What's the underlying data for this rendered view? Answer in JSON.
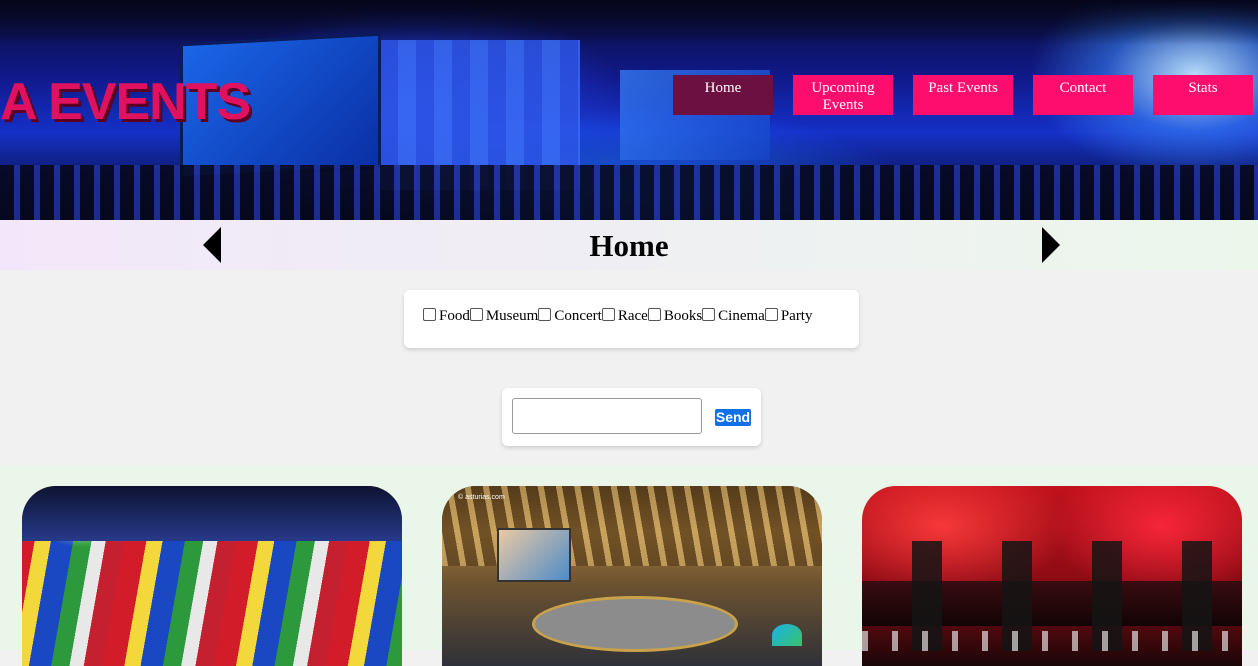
{
  "brand": {
    "logo_text": "A EVENTS",
    "accent_color": "#fc0d6e",
    "active_nav_color": "#6b1040"
  },
  "nav": {
    "items": [
      {
        "label": "Home",
        "active": true
      },
      {
        "label": "Upcoming Events",
        "active": false
      },
      {
        "label": "Past Events",
        "active": false
      },
      {
        "label": "Contact",
        "active": false
      },
      {
        "label": "Stats",
        "active": false
      }
    ]
  },
  "page": {
    "title": "Home",
    "prev_icon": "triangle-left-icon",
    "next_icon": "triangle-right-icon"
  },
  "filters": {
    "options": [
      {
        "label": "Food",
        "checked": false
      },
      {
        "label": "Museum",
        "checked": false
      },
      {
        "label": "Concert",
        "checked": false
      },
      {
        "label": "Race",
        "checked": false
      },
      {
        "label": "Books",
        "checked": false
      },
      {
        "label": "Cinema",
        "checked": false
      },
      {
        "label": "Party",
        "checked": false
      }
    ]
  },
  "search": {
    "value": "",
    "placeholder": "",
    "button_label": "Send"
  },
  "cards": {
    "items": [
      {
        "image": "flags-festival-photo"
      },
      {
        "image": "dinosaur-museum-photo",
        "watermark": "© asturias.com"
      },
      {
        "image": "rock-concert-photo"
      }
    ]
  }
}
